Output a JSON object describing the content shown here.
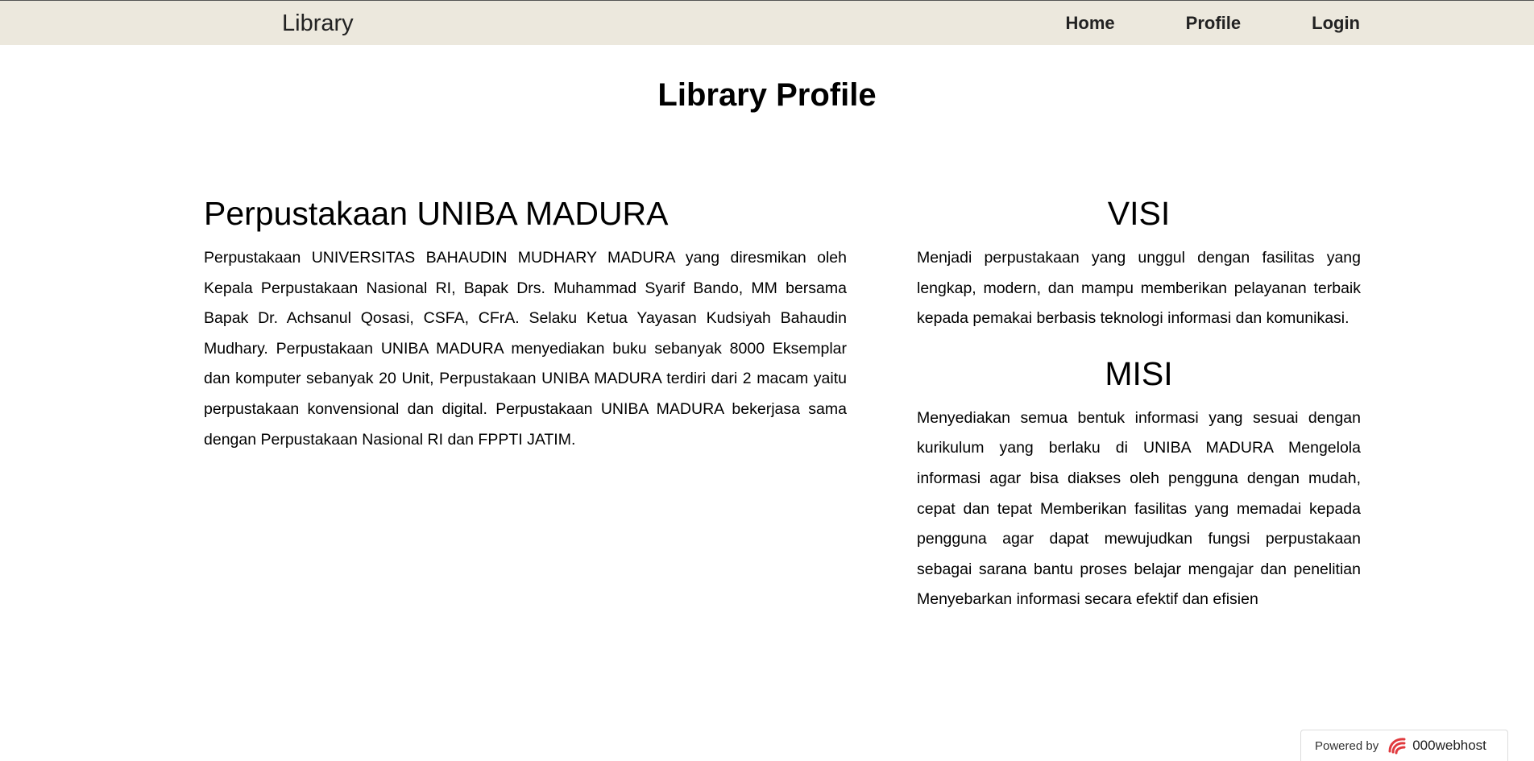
{
  "navbar": {
    "brand": "Library",
    "links": [
      "Home",
      "Profile",
      "Login"
    ]
  },
  "page_title": "Library Profile",
  "about": {
    "heading": "Perpustakaan UNIBA MADURA",
    "text": "Perpustakaan UNIVERSITAS BAHAUDIN MUDHARY MADURA yang diresmikan oleh Kepala Perpustakaan Nasional RI, Bapak Drs. Muhammad Syarif Bando, MM bersama Bapak Dr. Achsanul Qosasi, CSFA, CFrA. Selaku Ketua Yayasan Kudsiyah Bahaudin Mudhary. Perpustakaan UNIBA MADURA menyediakan buku sebanyak 8000 Eksemplar dan komputer sebanyak 20 Unit, Perpustakaan UNIBA MADURA terdiri dari 2 macam yaitu perpustakaan konvensional dan digital. Perpustakaan UNIBA MADURA bekerjasa sama dengan Perpustakaan Nasional RI dan FPPTI JATIM."
  },
  "visi": {
    "heading": "VISI",
    "text": "Menjadi perpustakaan yang unggul dengan fasilitas yang lengkap, modern, dan mampu memberikan pelayanan terbaik kepada pemakai berbasis teknologi informasi dan komunikasi."
  },
  "misi": {
    "heading": "MISI",
    "text": "Menyediakan semua bentuk informasi yang sesuai dengan kurikulum yang berlaku di UNIBA MADURA Mengelola informasi agar bisa diakses oleh pengguna dengan mudah, cepat dan tepat Memberikan fasilitas yang memadai kepada pengguna agar dapat mewujudkan fungsi perpustakaan sebagai sarana bantu proses belajar mengajar dan penelitian Menyebarkan informasi secara efektif dan efisien"
  },
  "badge": {
    "powered_by": "Powered by",
    "host": "000webhost",
    "icon": "000webhost-logo-icon"
  },
  "colors": {
    "navbar_bg": "#ece8dd",
    "logo_red": "#e03a3e"
  }
}
